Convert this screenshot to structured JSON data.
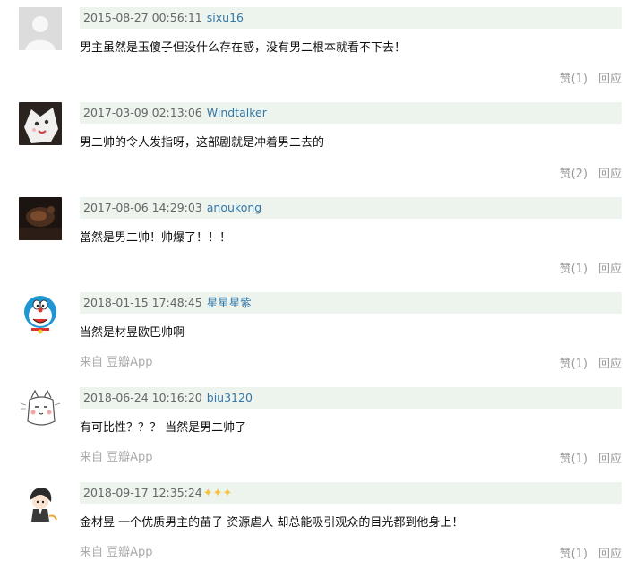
{
  "comments": [
    {
      "avatar_icon": "default-gray-person-icon",
      "time": "2015-08-27 00:56:11",
      "user": "sixu16",
      "text": "男主虽然是玉傻子但没什么存在感，没有男二根本就看不下去！",
      "source": "",
      "vote": "赞(1)",
      "reply": "回应"
    },
    {
      "avatar_icon": "white-cat-face-icon",
      "time": "2017-03-09 02:13:06",
      "user": "Windtalker",
      "text": "男二帅的令人发指呀，这部剧就是冲着男二去的",
      "source": "",
      "vote": "赞(2)",
      "reply": "回应"
    },
    {
      "avatar_icon": "dark-photo-icon",
      "time": "2017-08-06 14:29:03",
      "user": "anoukong",
      "text": "當然是男二帅！帅爆了！！！",
      "source": "",
      "vote": "赞(1)",
      "reply": "回应"
    },
    {
      "avatar_icon": "doraemon-icon",
      "time": "2018-01-15 17:48:45",
      "user": "星星星紫",
      "text": "当然是材昱欧巴帅啊",
      "source": "来自 豆瓣App",
      "vote": "赞(1)",
      "reply": "回应"
    },
    {
      "avatar_icon": "cartoon-cat-sketch-icon",
      "time": "2018-06-24 10:16:20",
      "user": "biu3120",
      "text": "有可比性？？？ 当然是男二帅了",
      "source": "来自 豆瓣App",
      "vote": "赞(1)",
      "reply": "回应"
    },
    {
      "avatar_icon": "anime-character-icon",
      "time": "2018-09-17 12:35:24",
      "user": "",
      "user_stars": "✦✦✦",
      "text": "金材昱 一个优质男主的苗子 资源虐人 却总能吸引观众的目光都到他身上！",
      "source": "来自 豆瓣App",
      "vote": "赞(1)",
      "reply": "回应"
    }
  ],
  "colors": {
    "meta_bg": "#edf4ed",
    "username": "#3377aa",
    "muted": "#999999"
  }
}
